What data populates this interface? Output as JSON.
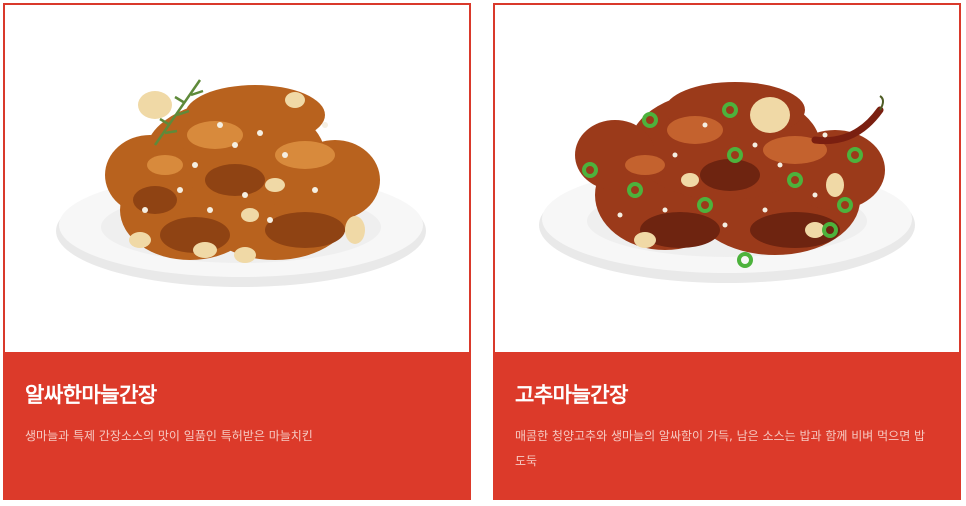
{
  "menu": [
    {
      "name": "알싸한마늘간장",
      "description": "생마늘과 특제 간장소스의 맛이 일품인 특허받은 마늘치킨",
      "image_alt": "garlic-soy-chicken-image"
    },
    {
      "name": "고추마늘간장",
      "description": "매콤한 청양고추와 생마늘의 알싸함이 가득, 남은 소스는 밥과 함께 비벼 먹으면 밥도둑",
      "image_alt": "pepper-garlic-soy-chicken-image"
    }
  ],
  "colors": {
    "accent": "#dc3a2a",
    "title_text": "#ffffff",
    "desc_text": "#f6c9c2"
  }
}
